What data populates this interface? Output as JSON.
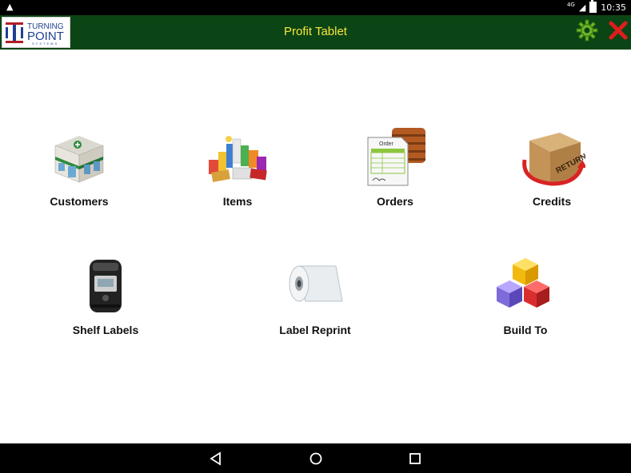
{
  "status_bar": {
    "time": "10:35",
    "network": "4G",
    "alert_icon": "warning-icon",
    "battery_icon": "battery-icon"
  },
  "app": {
    "title": "Profit Tablet",
    "logo": {
      "line1": "TURNING",
      "line2": "POINT",
      "line3": "SYSTEMS"
    },
    "accent_bar": "#0b4515",
    "title_color": "#f7e63a"
  },
  "header_actions": {
    "settings_icon": "gear-icon",
    "close_icon": "close-icon"
  },
  "menu": {
    "row1": [
      {
        "label": "Customers",
        "icon": "store-building-icon"
      },
      {
        "label": "Items",
        "icon": "grocery-products-icon"
      },
      {
        "label": "Orders",
        "icon": "order-form-icon"
      },
      {
        "label": "Credits",
        "icon": "return-box-icon"
      }
    ],
    "row2": [
      {
        "label": "Shelf Labels",
        "icon": "label-printer-icon"
      },
      {
        "label": "Label Reprint",
        "icon": "label-roll-icon"
      },
      {
        "label": "Build To",
        "icon": "cubes-icon"
      }
    ]
  },
  "nav_bar": {
    "back": "back-icon",
    "home": "home-icon",
    "recents": "recents-icon"
  }
}
